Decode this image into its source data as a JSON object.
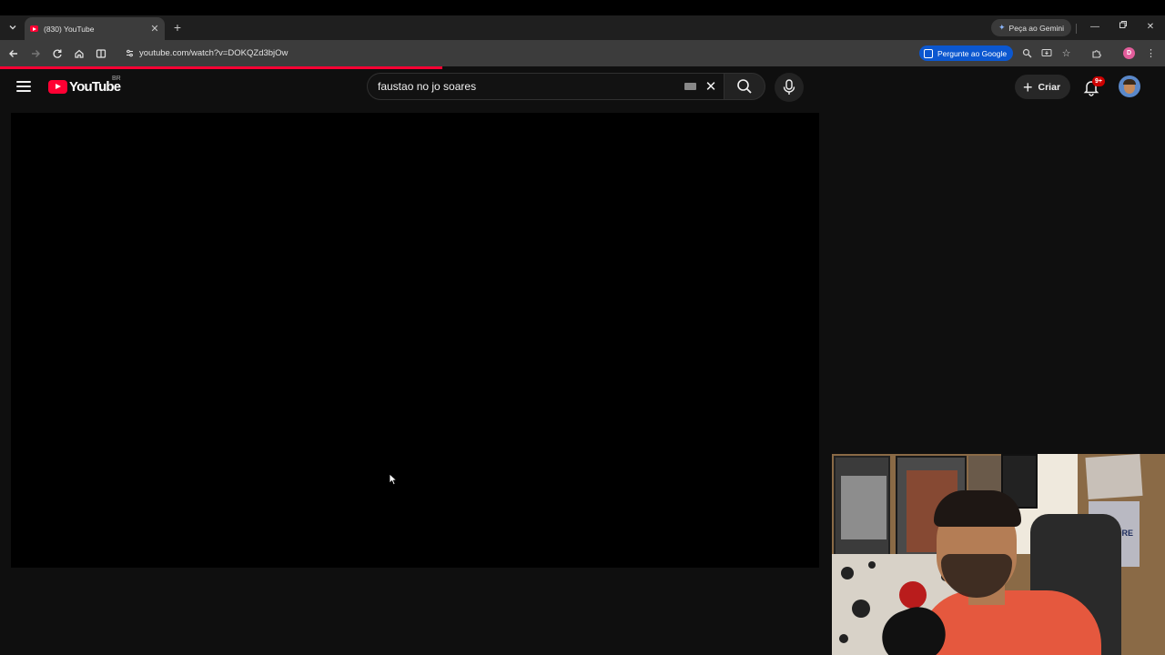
{
  "browser": {
    "tab_title": "(830) YouTube",
    "new_tab": "+",
    "gemini_label": "Peça ao Gemini",
    "url": "youtube.com/watch?v=DOKQZd3bjOw",
    "ask_google_label": "Pergunte ao Google",
    "profile_initial": "D",
    "load_progress_percent": 38
  },
  "youtube": {
    "logo_text": "YouTube",
    "region": "BR",
    "search_query": "faustao no jo soares",
    "create_label": "Criar",
    "notifications_badge": "9+"
  },
  "webcam": {
    "poster_text": "NO MORE"
  },
  "colors": {
    "accent_red": "#ff0033",
    "google_blue": "#0b57d0",
    "page_bg": "#0f0f0f"
  }
}
